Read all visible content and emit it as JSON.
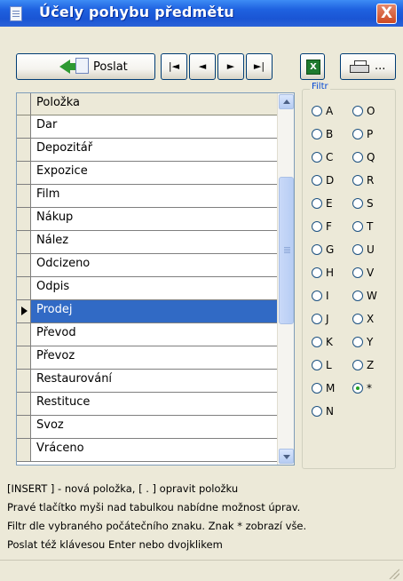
{
  "window": {
    "title": "Účely pohybu předmětu",
    "close_label": "X"
  },
  "toolbar": {
    "send_label": "Poslat",
    "nav": [
      {
        "name": "first-record-button",
        "glyph": "|◄"
      },
      {
        "name": "prev-record-button",
        "glyph": "◄"
      },
      {
        "name": "next-record-button",
        "glyph": "►"
      },
      {
        "name": "last-record-button",
        "glyph": "►|"
      }
    ],
    "excel_glyph": "X",
    "print_dots": "..."
  },
  "grid": {
    "header": "Položka",
    "rows": [
      "Dar",
      "Depozitář",
      "Expozice",
      "Film",
      "Nákup",
      "Nález",
      "Odcizeno",
      "Odpis",
      "Prodej",
      "Převod",
      "Převoz",
      "Restaurování",
      "Restituce",
      "Svoz",
      "Vráceno"
    ],
    "selected": "Prodej",
    "scroll_position": 0.35
  },
  "filter": {
    "label": "Filtr",
    "left": [
      "A",
      "B",
      "C",
      "D",
      "E",
      "F",
      "G",
      "H",
      "I",
      "J",
      "K",
      "L",
      "M",
      "N"
    ],
    "right": [
      "O",
      "P",
      "Q",
      "R",
      "S",
      "T",
      "U",
      "V",
      "W",
      "X",
      "Y",
      "Z",
      "*"
    ],
    "selected": "*"
  },
  "help": [
    "[INSERT ] - nová položka,  [ . ]  opravit položku",
    "Pravé  tlačítko myši nad  tabulkou nabídne možnost úprav.",
    "Filtr dle vybraného počátečního znaku. Znak * zobrazí vše.",
    "Poslat též klávesou Enter nebo dvojklikem"
  ]
}
